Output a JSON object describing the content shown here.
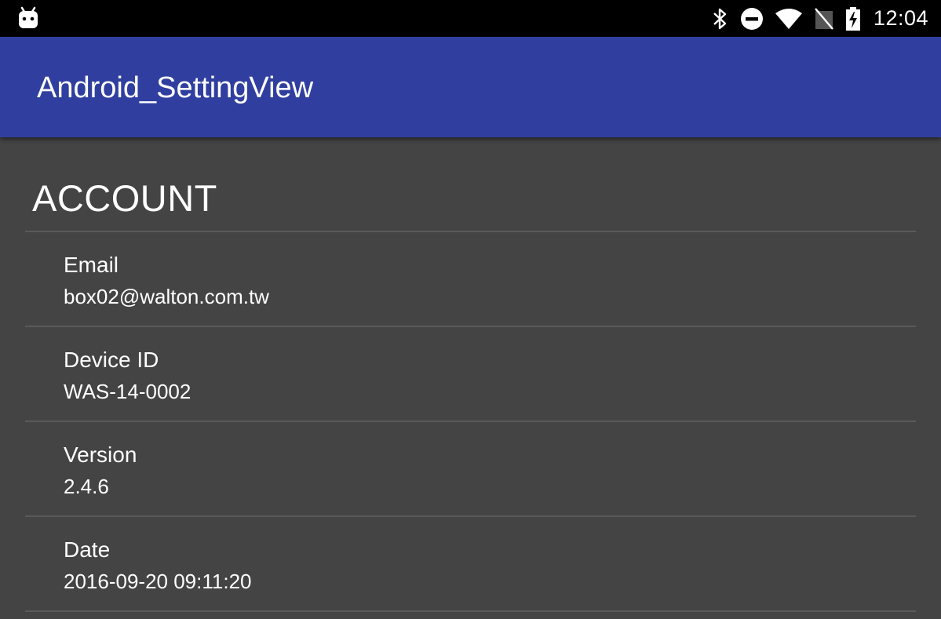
{
  "status_bar": {
    "left_icon": "android-robot-icon",
    "icons": [
      "bluetooth-icon",
      "do-not-disturb-icon",
      "wifi-icon",
      "no-sim-icon",
      "battery-charging-icon"
    ],
    "time": "12:04"
  },
  "app_bar": {
    "title": "Android_SettingView",
    "color": "#303F9F"
  },
  "section": {
    "title": "ACCOUNT"
  },
  "items": [
    {
      "title": "Email",
      "summary": "box02@walton.com.tw"
    },
    {
      "title": "Device ID",
      "summary": "WAS-14-0002"
    },
    {
      "title": "Version",
      "summary": "2.4.6"
    },
    {
      "title": "Date",
      "summary": "2016-09-20 09:11:20"
    }
  ],
  "colors": {
    "status_bar": "#000000",
    "background": "#444444",
    "divider": "#5a5a5a",
    "text": "#ffffff"
  }
}
